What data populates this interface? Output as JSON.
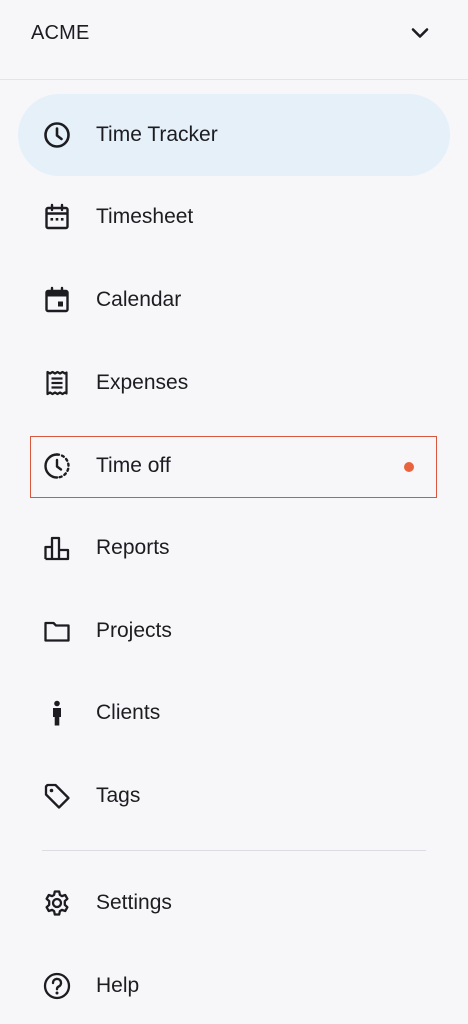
{
  "header": {
    "workspace": "ACME",
    "chevron_icon": "chevron-down-icon"
  },
  "nav": {
    "items": [
      {
        "label": "Time Tracker",
        "icon": "clock-icon",
        "active": true
      },
      {
        "label": "Timesheet",
        "icon": "timesheet-calendar-icon"
      },
      {
        "label": "Calendar",
        "icon": "calendar-icon"
      },
      {
        "label": "Expenses",
        "icon": "receipt-icon"
      },
      {
        "label": "Time off",
        "icon": "time-off-clock-icon",
        "notification": true
      },
      {
        "label": "Reports",
        "icon": "bar-chart-icon"
      },
      {
        "label": "Projects",
        "icon": "folder-icon"
      },
      {
        "label": "Clients",
        "icon": "person-icon"
      },
      {
        "label": "Tags",
        "icon": "tag-icon"
      }
    ],
    "footer_items": [
      {
        "label": "Settings",
        "icon": "gear-icon"
      },
      {
        "label": "Help",
        "icon": "help-circle-icon"
      }
    ]
  },
  "colors": {
    "active_background": "#e6f0f9",
    "highlight_border": "#d9573c",
    "notification_dot": "#e8643f",
    "icon": "#1d1d21"
  }
}
